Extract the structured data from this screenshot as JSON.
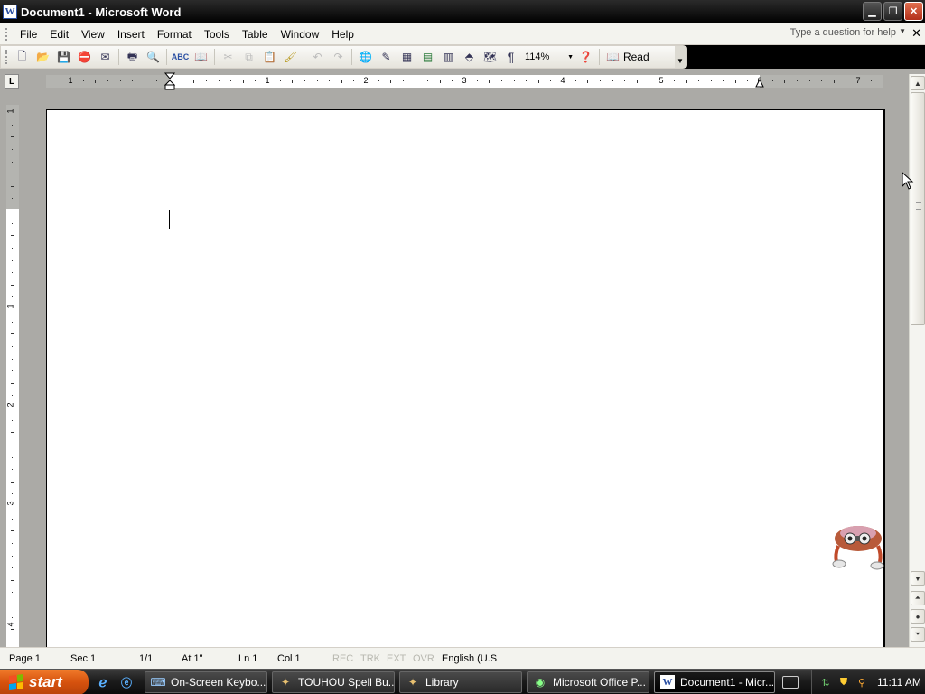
{
  "window": {
    "title": "Document1 - Microsoft Word",
    "icon": "word-icon"
  },
  "menubar": {
    "items": [
      "File",
      "Edit",
      "View",
      "Insert",
      "Format",
      "Tools",
      "Table",
      "Window",
      "Help"
    ],
    "help_placeholder": "Type a question for help"
  },
  "toolbar": {
    "zoom": "114%",
    "read_label": "Read"
  },
  "ruler": {
    "horizontal_numbers": [
      "1",
      "1",
      "2",
      "3",
      "4",
      "5",
      "6",
      "7"
    ],
    "vertical_numbers": [
      "1",
      "1",
      "2",
      "3",
      "4"
    ]
  },
  "statusbar": {
    "page": "Page  1",
    "sec": "Sec  1",
    "pages": "1/1",
    "at": "At  1\"",
    "ln": "Ln  1",
    "col": "Col  1",
    "rec": "REC",
    "trk": "TRK",
    "ext": "EXT",
    "ovr": "OVR",
    "language": "English (U.S"
  },
  "taskbar": {
    "start_label": "start",
    "tasks": [
      {
        "label": "On-Screen Keybo...",
        "icon": "keyboard-icon"
      },
      {
        "label": "TOUHOU Spell Bu...",
        "icon": "game-icon"
      },
      {
        "label": "Library",
        "icon": "library-icon"
      },
      {
        "label": "Microsoft Office P...",
        "icon": "office-icon"
      },
      {
        "label": "Document1 - Micr...",
        "icon": "word-icon"
      }
    ],
    "clock": "11:11 AM"
  }
}
